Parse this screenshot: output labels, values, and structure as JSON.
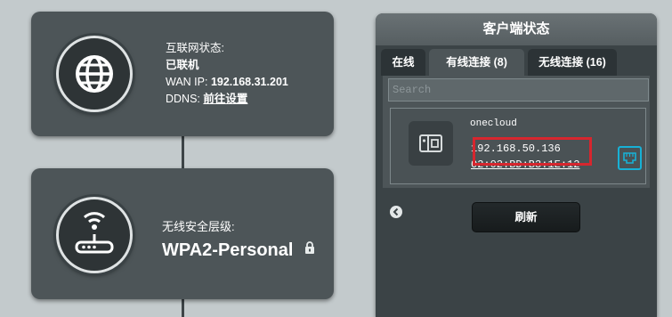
{
  "internet_card": {
    "status_label": "互联网状态:",
    "status_value": "已联机",
    "wan_ip_label": "WAN IP:",
    "wan_ip_value": "192.168.31.201",
    "ddns_label": "DDNS:",
    "ddns_link": "前往设置",
    "icon": "globe-icon"
  },
  "wireless_card": {
    "security_label": "无线安全层级:",
    "security_value": "WPA2-Personal",
    "icon": "router-icon",
    "lock_icon": "lock-icon"
  },
  "client_panel": {
    "title": "客户端状态",
    "tabs": [
      {
        "label": "在线"
      },
      {
        "label": "有线连接 (8)"
      },
      {
        "label": "无线连接 (16)"
      }
    ],
    "active_tab": "有线连接 (8)",
    "search_placeholder": "Search",
    "client": {
      "name": "onecloud",
      "ip": "192.168.50.136",
      "mac": "02:02:BD:B3:1E:12",
      "device_icon": "device-icon",
      "connection_icon": "ethernet-icon"
    },
    "refresh_label": "刷新",
    "back_icon": "back-icon"
  },
  "colors": {
    "background": "#c3cacc",
    "card": "#4d5558",
    "highlight": "#d7262e",
    "accent": "#17b1d6"
  }
}
